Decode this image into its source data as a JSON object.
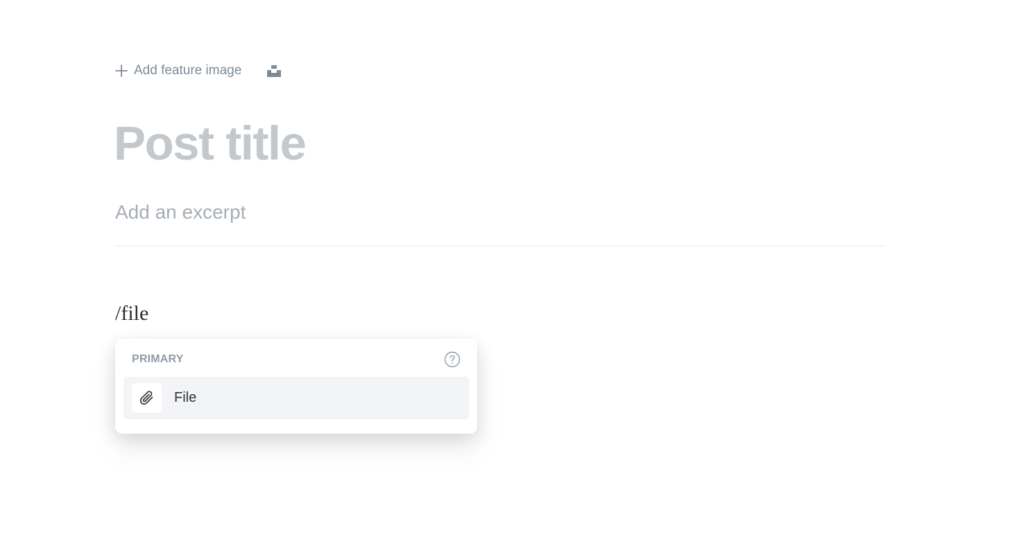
{
  "feature_image": {
    "label": "Add feature image",
    "icon": "plus-icon",
    "unsplash_icon": "unsplash-icon"
  },
  "post": {
    "title_placeholder": "Post title",
    "excerpt_placeholder": "Add an excerpt",
    "body_text": "/file"
  },
  "slash_menu": {
    "section_label": "PRIMARY",
    "help_icon": "help-circle-icon",
    "items": [
      {
        "label": "File",
        "icon": "paperclip-icon"
      }
    ]
  },
  "colors": {
    "muted_text": "#7c8b9a",
    "title_placeholder": "#c3c8cd",
    "excerpt_placeholder": "#a5adb5",
    "selected_item_bg": "#f3f4f6"
  }
}
